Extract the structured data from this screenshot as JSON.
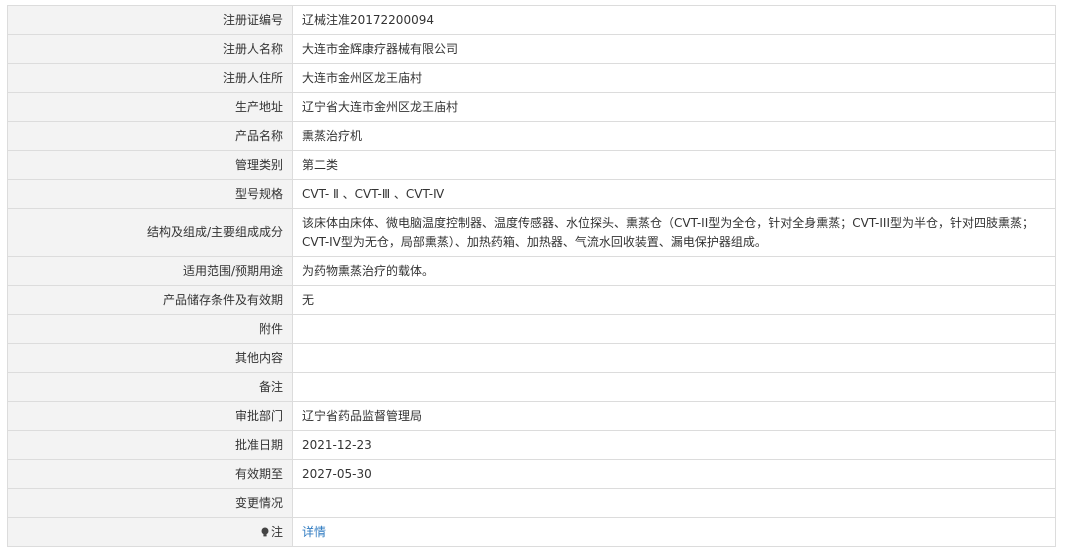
{
  "rows": [
    {
      "label": "注册证编号",
      "value": "辽械注准20172200094"
    },
    {
      "label": "注册人名称",
      "value": "大连市金辉康疗器械有限公司"
    },
    {
      "label": "注册人住所",
      "value": "大连市金州区龙王庙村"
    },
    {
      "label": "生产地址",
      "value": "辽宁省大连市金州区龙王庙村"
    },
    {
      "label": "产品名称",
      "value": "熏蒸治疗机"
    },
    {
      "label": "管理类别",
      "value": "第二类"
    },
    {
      "label": "型号规格",
      "value": "CVT- Ⅱ 、CVT-Ⅲ 、CVT-Ⅳ"
    },
    {
      "label": "结构及组成/主要组成成分",
      "value": "该床体由床体、微电脑温度控制器、温度传感器、水位探头、熏蒸仓（CVT-II型为全仓，针对全身熏蒸；CVT-III型为半仓，针对四肢熏蒸；CVT-IV型为无仓，局部熏蒸）、加热药箱、加热器、气流水回收装置、漏电保护器组成。"
    },
    {
      "label": "适用范围/预期用途",
      "value": "为药物熏蒸治疗的载体。"
    },
    {
      "label": "产品储存条件及有效期",
      "value": "无"
    },
    {
      "label": "附件",
      "value": ""
    },
    {
      "label": "其他内容",
      "value": ""
    },
    {
      "label": "备注",
      "value": ""
    },
    {
      "label": "审批部门",
      "value": "辽宁省药品监督管理局"
    },
    {
      "label": "批准日期",
      "value": "2021-12-23"
    },
    {
      "label": "有效期至",
      "value": "2027-05-30"
    },
    {
      "label": "变更情况",
      "value": ""
    },
    {
      "label": "注",
      "value": "详情",
      "icon": "lightbulb-icon"
    }
  ],
  "colors": {
    "label_bg": "#f3f3f3",
    "border": "#dcdcdc",
    "link": "#2f7bc1"
  }
}
